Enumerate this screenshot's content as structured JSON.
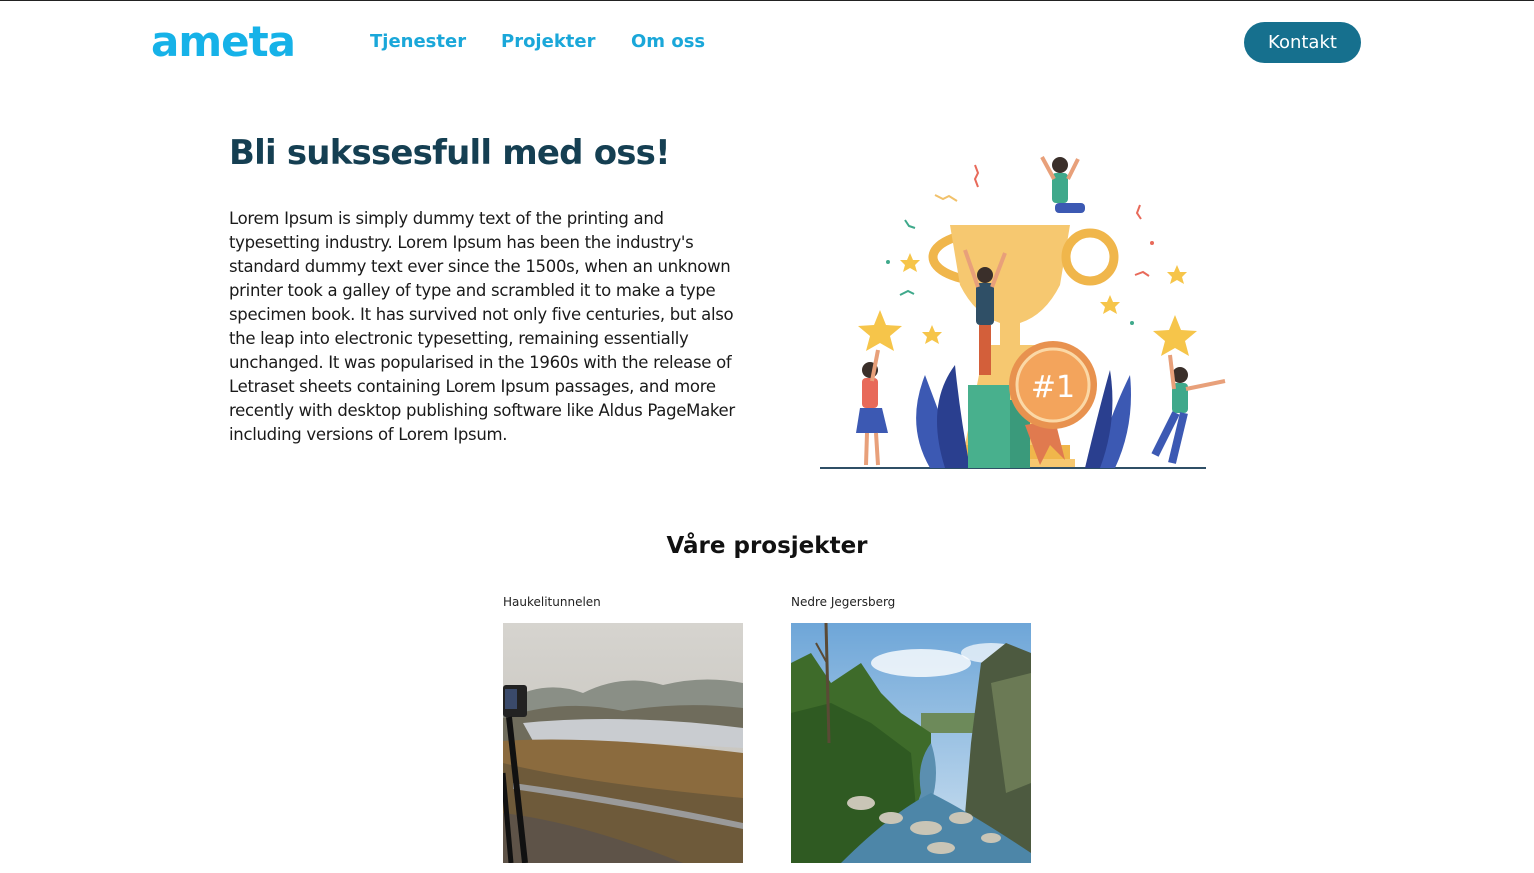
{
  "header": {
    "logo_text": "ameta",
    "nav": [
      {
        "label": "Tjenester"
      },
      {
        "label": "Projekter"
      },
      {
        "label": "Om oss"
      }
    ],
    "contact_label": "Kontakt"
  },
  "hero": {
    "title": "Bli sukssesfull med oss!",
    "body": "Lorem Ipsum is simply dummy text of the printing and typesetting industry. Lorem Ipsum has been the industry's standard dummy text ever since the 1500s, when an unknown printer took a galley of type and scrambled it to make a type specimen book. It has survived not only five centuries, but also the leap into electronic typesetting, remaining essentially unchanged. It was popularised in the 1960s with the release of Letraset sheets containing Lorem Ipsum passages, and more recently with desktop publishing software like Aldus PageMaker including versions of Lorem Ipsum.",
    "badge_text": "#1"
  },
  "projects": {
    "title": "Våre prosjekter",
    "items": [
      {
        "name": "Haukelitunnelen"
      },
      {
        "name": "Nedre Jegersberg"
      }
    ]
  },
  "colors": {
    "brand": "#16b2e8",
    "nav": "#1aa7d9",
    "button": "#16708e",
    "heading": "#153f52"
  }
}
